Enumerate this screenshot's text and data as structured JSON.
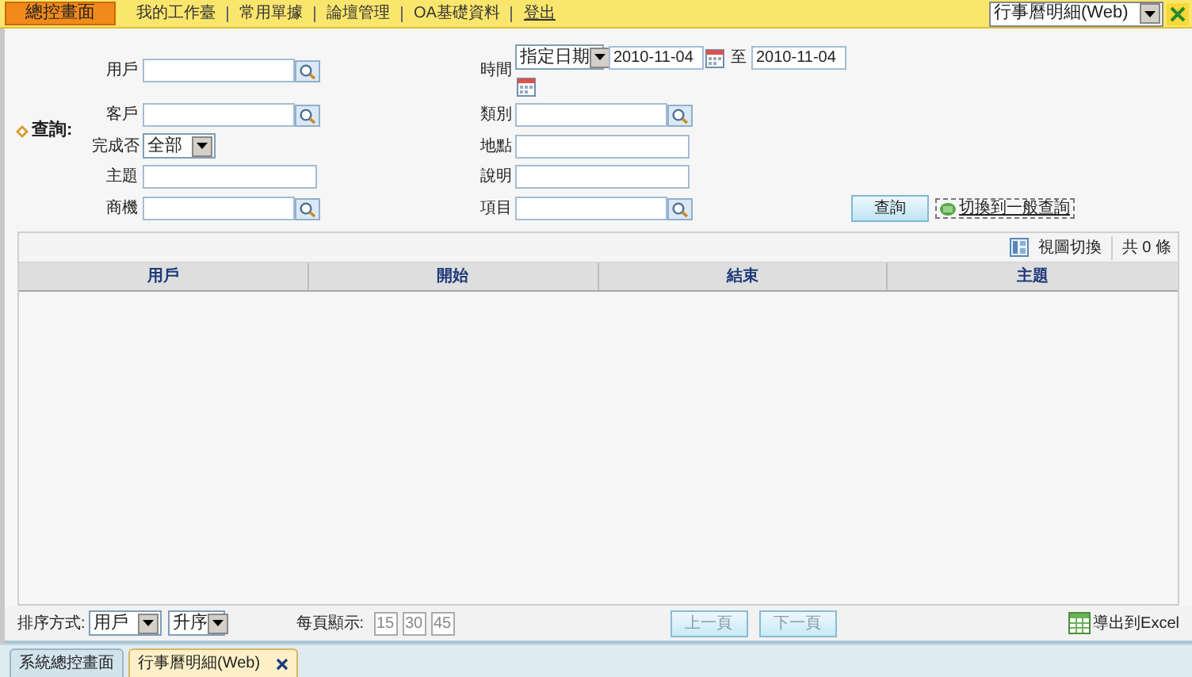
{
  "nav": {
    "items": [
      {
        "label": "總控畫面",
        "kind": "tab",
        "selected": true
      },
      {
        "label": "我的工作臺",
        "kind": "tab",
        "selected": false
      },
      {
        "label": "常用單據",
        "kind": "tab",
        "selected": false
      },
      {
        "label": "論壇管理",
        "kind": "tab",
        "selected": false
      },
      {
        "label": "OA基礎資料",
        "kind": "tab",
        "selected": false
      },
      {
        "label": "登出",
        "kind": "link"
      }
    ],
    "module_select": {
      "value": "行事曆明細(Web)"
    }
  },
  "query": {
    "label": "查詢:",
    "rows": [
      {
        "left": {
          "label": "用戶",
          "kind": "lookup"
        },
        "right": {
          "label": "時間",
          "kind": "daterange",
          "mode": "指定日期",
          "from": "2010-11-04",
          "separator": "至",
          "to": "2010-11-04"
        }
      },
      {
        "left": {
          "label": "客戶",
          "kind": "lookup"
        },
        "right": {
          "label": "類別",
          "kind": "lookup"
        }
      },
      {
        "left": {
          "label": "完成否",
          "kind": "select",
          "value": "全部"
        },
        "right": {
          "label": "地點",
          "kind": "text"
        }
      },
      {
        "left": {
          "label": "主題",
          "kind": "text"
        },
        "right": {
          "label": "說明",
          "kind": "text"
        }
      },
      {
        "left": {
          "label": "商機",
          "kind": "lookup"
        },
        "right": {
          "label": "項目",
          "kind": "lookup"
        }
      }
    ],
    "search_button": "查詢",
    "switch_link": "切換到一般查詢"
  },
  "table": {
    "view_switch": "視圖切換",
    "count": "共 0 條",
    "columns": [
      "用戶",
      "開始",
      "結束",
      "主題"
    ]
  },
  "footer": {
    "sort_label": "排序方式:",
    "sort_field": "用戶",
    "sort_order": "升序",
    "page_size_label": "每頁顯示:",
    "page_sizes": [
      "15",
      "30",
      "45"
    ],
    "prev": "上一頁",
    "next": "下一頁",
    "export": "導出到Excel"
  },
  "tabs": [
    {
      "label": "系統總控畫面",
      "selected": false,
      "closable": false
    },
    {
      "label": "行事曆明細(Web)",
      "selected": true,
      "closable": true
    }
  ]
}
